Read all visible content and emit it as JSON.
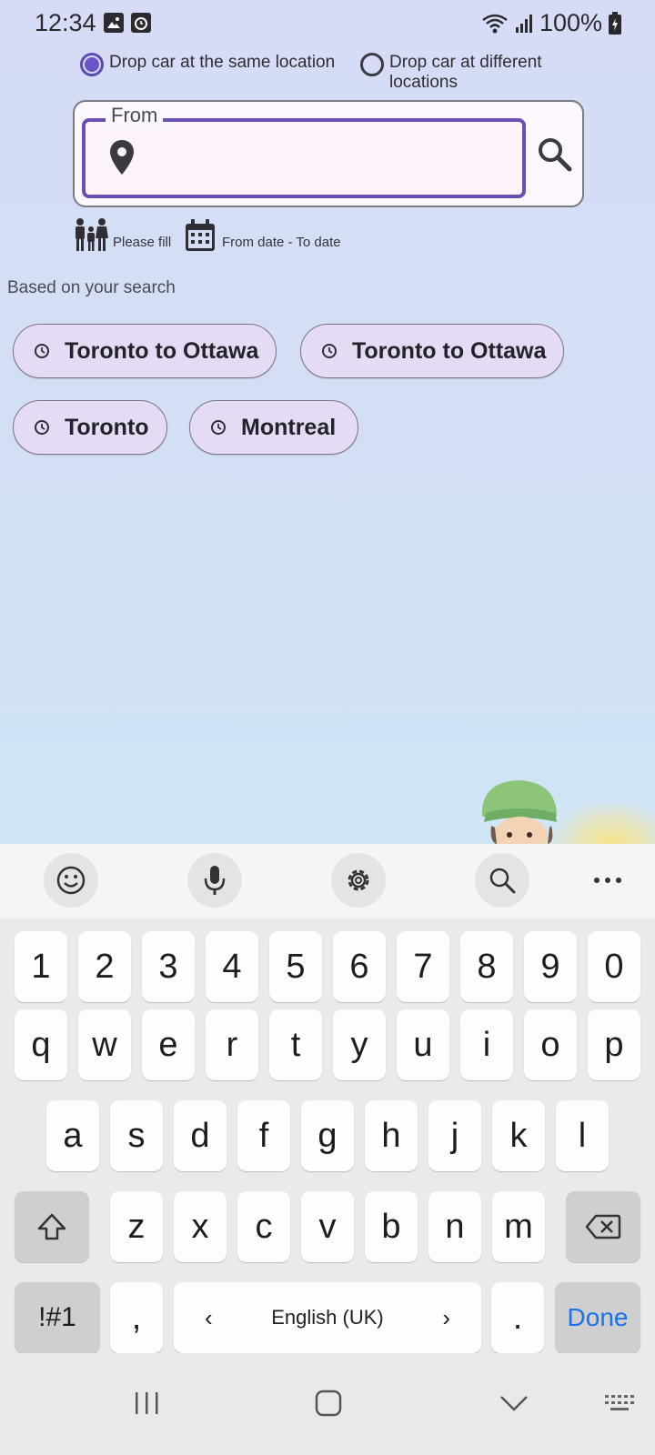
{
  "status_bar": {
    "time": "12:34",
    "battery": "100%",
    "icons": [
      "gallery-icon",
      "clock-app-icon",
      "wifi-icon",
      "signal-icon",
      "battery-charging-icon"
    ]
  },
  "drop_options": {
    "same": {
      "label": "Drop car at the same location",
      "selected": true
    },
    "different": {
      "label_line1": "Drop car at different",
      "label_line2": "locations",
      "selected": false
    }
  },
  "search": {
    "from_label": "From",
    "from_value": "",
    "icons": [
      "location-pin-icon",
      "search-icon"
    ]
  },
  "meta": {
    "passengers": "Please fill",
    "dates": "From date - To date"
  },
  "recent": {
    "title": "Based on your search",
    "chips": [
      "Toronto to Ottawa",
      "Toronto to Ottawa",
      "Toronto",
      "Montreal"
    ]
  },
  "keyboard": {
    "toolbar": [
      "emoji-icon",
      "microphone-icon",
      "settings-icon",
      "search-icon",
      "more-icon"
    ],
    "row_numbers": [
      "1",
      "2",
      "3",
      "4",
      "5",
      "6",
      "7",
      "8",
      "9",
      "0"
    ],
    "row_top": [
      "q",
      "w",
      "e",
      "r",
      "t",
      "y",
      "u",
      "i",
      "o",
      "p"
    ],
    "row_middle": [
      "a",
      "s",
      "d",
      "f",
      "g",
      "h",
      "j",
      "k",
      "l"
    ],
    "row_bottom": [
      "z",
      "x",
      "c",
      "v",
      "b",
      "n",
      "m"
    ],
    "symbols_key": "!#1",
    "comma_key": ",",
    "space_label": "English (UK)",
    "period_key": ".",
    "done_key": "Done"
  },
  "colors": {
    "accent": "#6a4fb3",
    "chip_bg": "#e6dbf4",
    "done_blue": "#1a73e8"
  }
}
